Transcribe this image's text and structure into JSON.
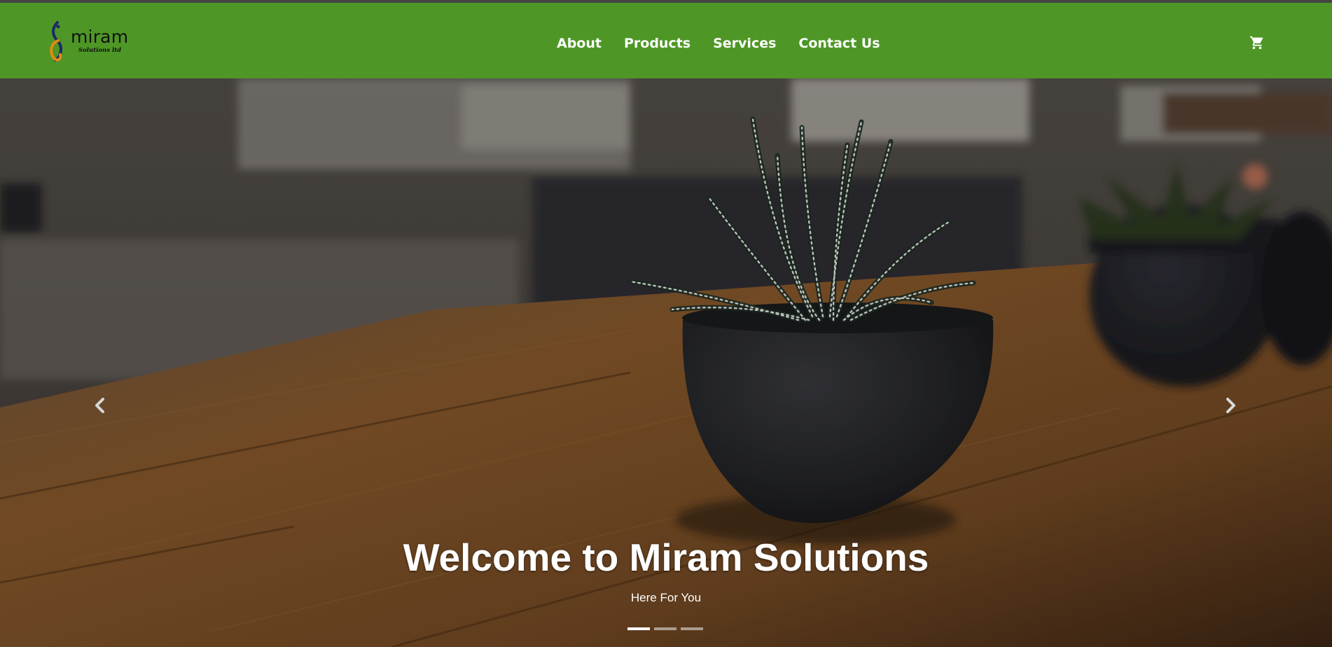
{
  "header": {
    "logo": {
      "name": "miram",
      "tagline": "Solutions ltd"
    },
    "nav_items": [
      {
        "label": "About"
      },
      {
        "label": "Products"
      },
      {
        "label": "Services"
      },
      {
        "label": "Contact Us"
      }
    ],
    "cart_icon": "shopping-cart-icon"
  },
  "hero": {
    "title": "Welcome to Miram Solutions",
    "subtitle": "Here For You",
    "prev_icon": "chevron-left-icon",
    "next_icon": "chevron-right-icon",
    "slide_count": 3,
    "active_slide": 1
  },
  "colors": {
    "header_bg": "#4e9726",
    "nav_text": "#ffffff",
    "caption_text": "#ffffff"
  }
}
